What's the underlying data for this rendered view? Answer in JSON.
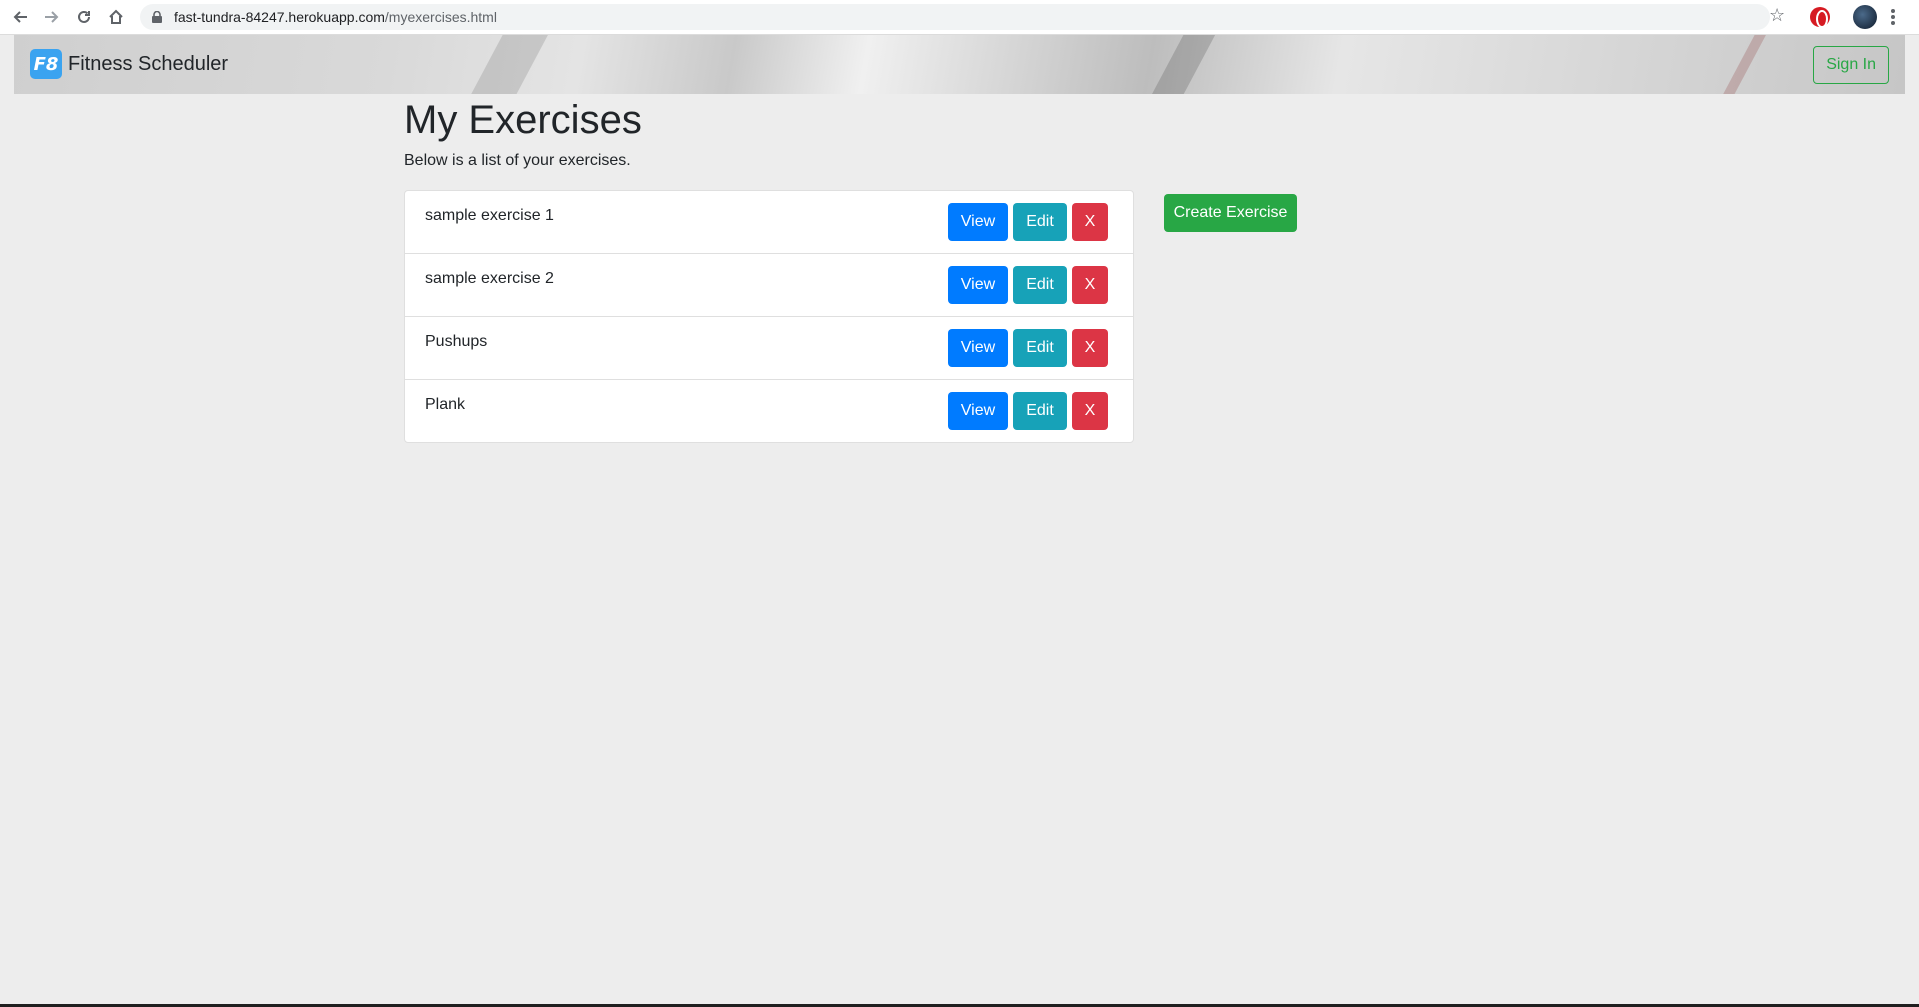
{
  "browser": {
    "url_host": "fast-tundra-84247.herokuapp.com",
    "url_path": "/myexercises.html"
  },
  "navbar": {
    "logo_text": "F8",
    "brand": "Fitness Scheduler",
    "signin_label": "Sign In"
  },
  "main": {
    "title": "My Exercises",
    "description": "Below is a list of your exercises.",
    "create_label": "Create Exercise",
    "exercises": [
      {
        "name": "sample exercise 1",
        "view": "View",
        "edit": "Edit",
        "delete": "X"
      },
      {
        "name": "sample exercise 2",
        "view": "View",
        "edit": "Edit",
        "delete": "X"
      },
      {
        "name": "Pushups",
        "view": "View",
        "edit": "Edit",
        "delete": "X"
      },
      {
        "name": "Plank",
        "view": "View",
        "edit": "Edit",
        "delete": "X"
      }
    ]
  },
  "colors": {
    "primary": "#007bff",
    "info": "#17a2b8",
    "danger": "#dc3545",
    "success": "#28a745"
  }
}
